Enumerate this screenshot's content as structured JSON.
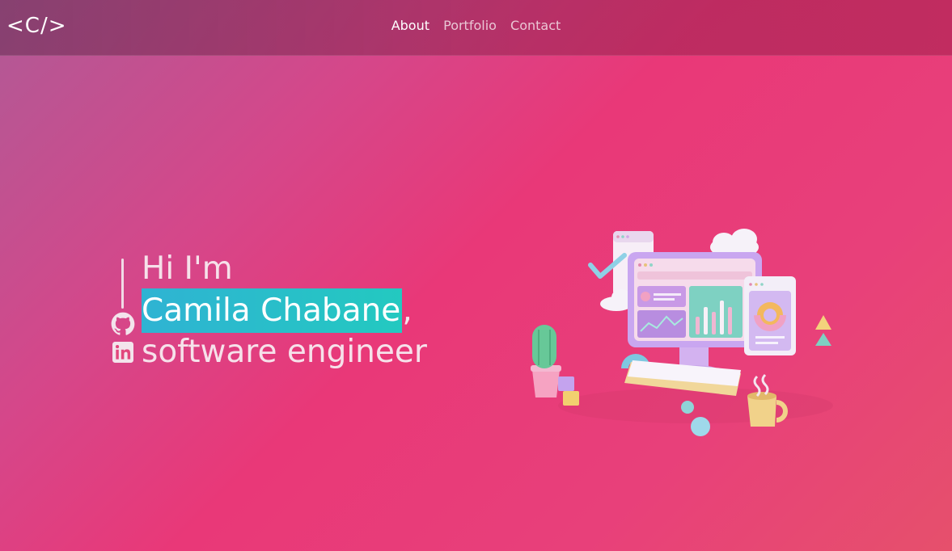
{
  "nav": {
    "logo": "<C/>",
    "links": [
      {
        "label": "About",
        "active": true
      },
      {
        "label": "Portfolio",
        "active": false
      },
      {
        "label": "Contact",
        "active": false
      }
    ]
  },
  "hero": {
    "greeting": "Hi I'm",
    "name": "Camila Chabane",
    "name_suffix": ",",
    "role": "software engineer"
  },
  "social": {
    "icons": [
      "github-icon",
      "linkedin-icon"
    ]
  },
  "colors": {
    "highlight_start": "#2fb3d3",
    "highlight_end": "#23c9c0",
    "bg_pink": "#e93878"
  }
}
